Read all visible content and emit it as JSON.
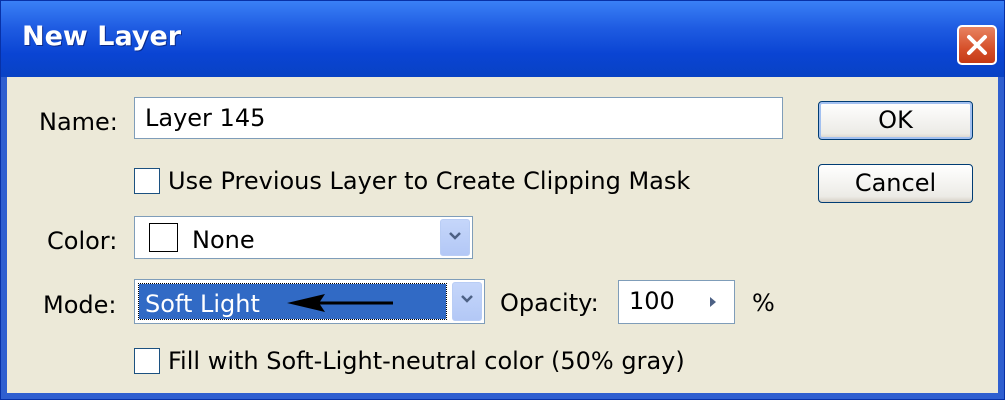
{
  "window": {
    "title": "New Layer"
  },
  "form": {
    "name_label": "Name:",
    "name_value": "Layer 145",
    "clip_label": "Use Previous Layer to Create Clipping Mask",
    "color_label": "Color:",
    "color_value": "None",
    "mode_label": "Mode:",
    "mode_value": "Soft Light",
    "opacity_label": "Opacity:",
    "opacity_value": "100",
    "opacity_unit": "%",
    "fill_label": "Fill with Soft-Light-neutral color (50% gray)"
  },
  "buttons": {
    "ok": "OK",
    "cancel": "Cancel"
  },
  "colors": {
    "titlebar": "#0a44d3",
    "client": "#ece9d8",
    "selection": "#316ac5",
    "close": "#d6502a"
  }
}
